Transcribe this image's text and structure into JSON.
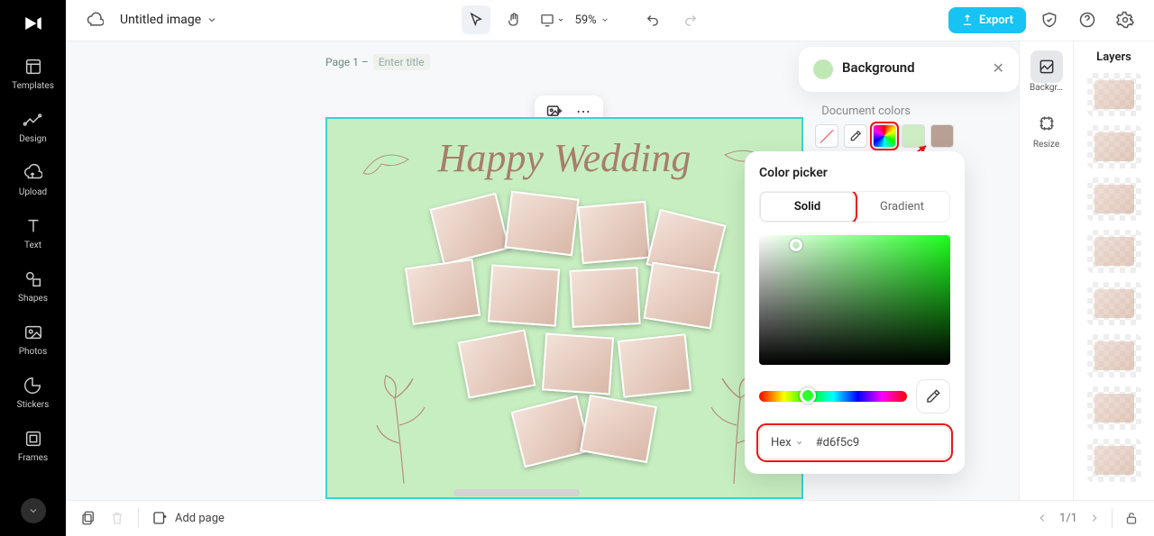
{
  "sidebar": {
    "items": [
      {
        "label": "Templates"
      },
      {
        "label": "Design"
      },
      {
        "label": "Upload"
      },
      {
        "label": "Text"
      },
      {
        "label": "Shapes"
      },
      {
        "label": "Photos"
      },
      {
        "label": "Stickers"
      },
      {
        "label": "Frames"
      }
    ]
  },
  "topbar": {
    "doc_title": "Untitled image",
    "zoom": "59%",
    "export_label": "Export"
  },
  "canvas": {
    "page_label_prefix": "Page 1 –",
    "page_title_placeholder": "Enter title",
    "heading": "Happy Wedding"
  },
  "background_panel": {
    "title": "Background",
    "doc_colors_label": "Document colors",
    "swatches": {
      "green": "#cdeec5",
      "taupe": "#b9a095"
    }
  },
  "color_picker": {
    "title": "Color picker",
    "tabs": {
      "solid": "Solid",
      "gradient": "Gradient"
    },
    "format_label": "Hex",
    "hex_value": "#d6f5c9"
  },
  "right_rail": {
    "items": [
      {
        "label": "Backgr…"
      },
      {
        "label": "Resize"
      }
    ]
  },
  "layers": {
    "title": "Layers",
    "count": 8
  },
  "bottombar": {
    "add_page_label": "Add page",
    "page_indicator": "1/1"
  }
}
